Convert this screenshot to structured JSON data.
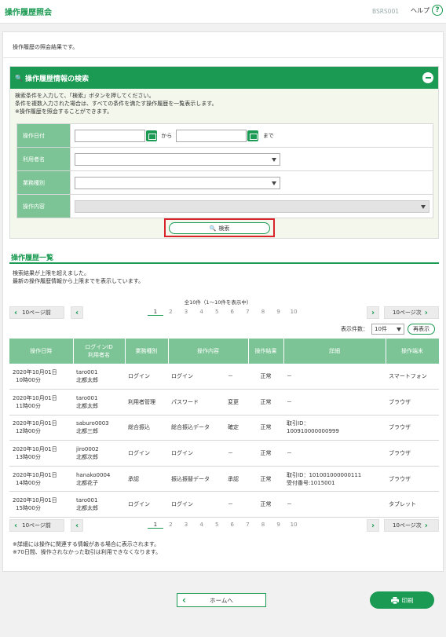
{
  "header": {
    "title": "操作履歴照会",
    "screen_code": "BSRS001",
    "help_label": "ヘルプ",
    "help_icon": "?"
  },
  "intro_text": "操作履歴の照会結果です。",
  "search_panel": {
    "title": "操作履歴情報の検索",
    "instructions": [
      "検索条件を入力して、「検索」ボタンを押してください。",
      "条件を複数入力された場合は、すべての条件を満たす操作履歴を一覧表示します。",
      "※操作履歴を照会することができます。"
    ],
    "fields": {
      "date_label": "操作日付",
      "date_from_word": "から",
      "date_to_word": "まで",
      "date_from_value": "",
      "date_to_value": "",
      "user_label": "利用者名",
      "user_value": "",
      "business_label": "業務種別",
      "business_value": "",
      "operation_label": "操作内容",
      "operation_value": ""
    },
    "search_button": "検索"
  },
  "list": {
    "title": "操作履歴一覧",
    "notice": [
      "検索結果が上限を超えました。",
      "最新の操作履歴情報から上限までを表示しています。"
    ],
    "total_text": "全10件（1～10件を表示中）",
    "pager": {
      "prev_label": "10ページ前",
      "next_label": "10ページ次",
      "pages": [
        "1",
        "2",
        "3",
        "4",
        "5",
        "6",
        "7",
        "8",
        "9",
        "10"
      ],
      "current": "1"
    },
    "display_count_label": "表示件数：",
    "display_count_value": "10件",
    "redisplay_label": "再表示",
    "columns": [
      "操作日時",
      "ログインID\n利用者名",
      "業務種別",
      "操作内容",
      "",
      "操作結果",
      "詳細",
      "操作端末"
    ],
    "rows": [
      {
        "date": "2020年10月01日",
        "time": "10時00分",
        "id": "taro001",
        "name": "北都太郎",
        "business": "ログイン",
        "operation": "ログイン",
        "sub": "－",
        "result": "正常",
        "detail1": "－",
        "detail2": "",
        "terminal": "スマートフォン"
      },
      {
        "date": "2020年10月01日",
        "time": "11時00分",
        "id": "taro001",
        "name": "北都太郎",
        "business": "利用者管理",
        "operation": "パスワード",
        "sub": "変更",
        "result": "正常",
        "detail1": "－",
        "detail2": "",
        "terminal": "ブラウザ"
      },
      {
        "date": "2020年10月01日",
        "time": "12時00分",
        "id": "saburo0003",
        "name": "北都三郎",
        "business": "総合振込",
        "operation": "総合振込データ",
        "sub": "確定",
        "result": "正常",
        "detail1": "取引ID：",
        "detail2": "100910000000999",
        "terminal": "ブラウザ"
      },
      {
        "date": "2020年10月01日",
        "time": "13時00分",
        "id": "jiro0002",
        "name": "北都次郎",
        "business": "ログイン",
        "operation": "ログイン",
        "sub": "－",
        "result": "正常",
        "detail1": "－",
        "detail2": "",
        "terminal": "ブラウザ"
      },
      {
        "date": "2020年10月01日",
        "time": "14時00分",
        "id": "hanako0004",
        "name": "北都花子",
        "business": "承認",
        "operation": "振込振替データ",
        "sub": "承認",
        "result": "正常",
        "detail1": "取引ID：101001000000111",
        "detail2": "受付番号:1015001",
        "terminal": "ブラウザ"
      },
      {
        "date": "2020年10月01日",
        "time": "15時00分",
        "id": "taro001",
        "name": "北都太郎",
        "business": "ログイン",
        "operation": "ログイン",
        "sub": "－",
        "result": "正常",
        "detail1": "－",
        "detail2": "",
        "terminal": "タブレット"
      }
    ],
    "footnotes": [
      "※詳細には操作に関連する情報がある場合に表示されます。",
      "※70日間、操作されなかった取引は利用できなくなります。"
    ]
  },
  "bottom": {
    "home_label": "ホームへ",
    "print_label": "印刷"
  },
  "colors": {
    "accent": "#1a9a52",
    "label_bg": "#7cc495",
    "highlight": "#d8232a"
  }
}
